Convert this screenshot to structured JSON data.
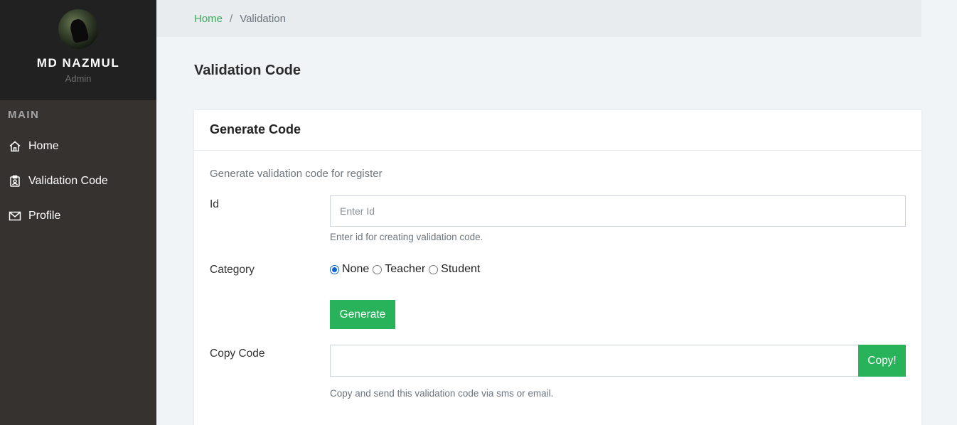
{
  "sidebar": {
    "user": {
      "name": "MD NAZMUL",
      "role": "Admin"
    },
    "heading": "MAIN",
    "items": [
      {
        "label": "Home",
        "icon": "home-icon"
      },
      {
        "label": "Validation Code",
        "icon": "badge-icon"
      },
      {
        "label": "Profile",
        "icon": "mail-icon"
      }
    ]
  },
  "breadcrumb": {
    "home": "Home",
    "separator": "/",
    "current": "Validation"
  },
  "page": {
    "title": "Validation Code"
  },
  "card": {
    "title": "Generate Code",
    "description": "Generate validation code for register",
    "id_field": {
      "label": "Id",
      "placeholder": "Enter Id",
      "value": "",
      "help": "Enter id for creating validation code."
    },
    "category": {
      "label": "Category",
      "options": [
        "None",
        "Teacher",
        "Student"
      ],
      "selected": "None"
    },
    "generate_button": "Generate",
    "copy_field": {
      "label": "Copy Code",
      "value": "",
      "button": "Copy!",
      "help": "Copy and send this validation code via sms or email."
    }
  },
  "colors": {
    "accent": "#28b35a",
    "link": "#3aaa5c",
    "sidebar_bg": "#353230",
    "sidebar_header_bg": "#222121"
  }
}
